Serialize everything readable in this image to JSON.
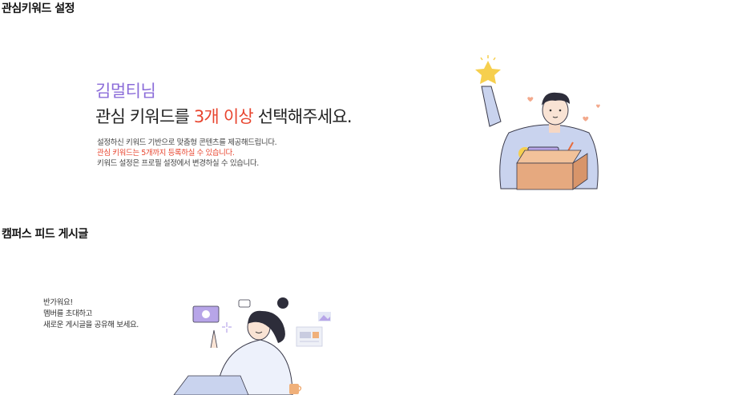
{
  "sections": {
    "keyword": {
      "title": "관심키워드 설정",
      "user_name": "김멀티님",
      "headline_prefix": "관심 키워드를 ",
      "headline_accent": "3개 이상",
      "headline_suffix": " 선택해주세요.",
      "desc_line1": "설정하신 키워드 기반으로 맞춤형 콘텐츠를 제공해드립니다.",
      "desc_line2": "관심 키워드는 5개까지 등록하실 수 있습니다.",
      "desc_line3": "키워드 설정은 프로필 설정에서 변경하실 수 있습니다."
    },
    "feed": {
      "title": "캠퍼스 피드 게시글",
      "line1": "반가워요!",
      "line2": "멤버를 초대하고",
      "line3": "새로운 게시글을 공유해 보세요."
    }
  },
  "colors": {
    "accent_purple": "#8b6cd9",
    "accent_red": "#e8452f",
    "illustration_lavender": "#c9d3ee",
    "box_tan": "#e6a97f",
    "star_yellow": "#f6cf4e"
  },
  "icons": {
    "keyword_illustration": "person-holding-star-with-box",
    "feed_illustration": "person-with-laptop-and-media-cards"
  }
}
